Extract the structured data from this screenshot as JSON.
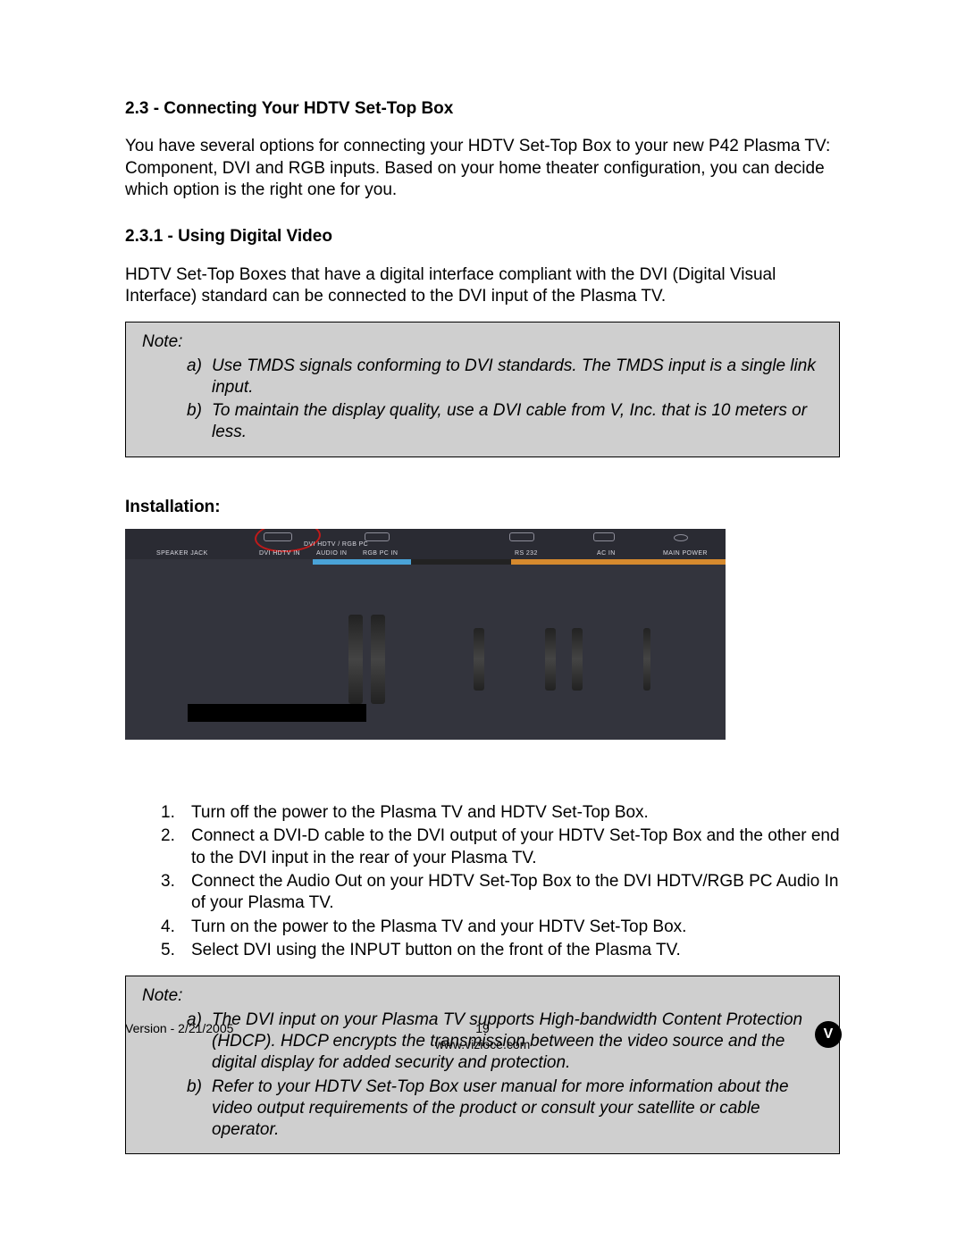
{
  "section": {
    "heading": "2.3 - Connecting Your HDTV Set-Top Box",
    "intro": "You have several options for connecting your HDTV Set-Top Box to your new P42 Plasma TV: Component, DVI and RGB inputs.  Based on your home theater configuration, you can decide which option is the right one for you."
  },
  "subsection": {
    "heading": "2.3.1 - Using Digital Video",
    "intro": "HDTV Set-Top Boxes that have a digital interface compliant with the DVI (Digital Visual Interface) standard can be connected to the DVI input of the Plasma TV."
  },
  "note1": {
    "label": "Note:",
    "items": [
      {
        "marker": "a)",
        "text": "Use TMDS signals conforming to DVI standards. The TMDS input is a single link input."
      },
      {
        "marker": "b)",
        "text": "To maintain the display quality, use a DVI cable from V, Inc. that is 10 meters or less."
      }
    ]
  },
  "installation": {
    "heading": "Installation:"
  },
  "diagram": {
    "labels": {
      "speaker_jack": "SPEAKER JACK",
      "dvi_hdtv_in": "DVI HDTV IN",
      "audio_in": "AUDIO IN",
      "dvi_rgb_pc": "DVI HDTV / RGB PC",
      "rgb_pc_in": "RGB PC IN",
      "rs232": "RS 232",
      "ac_in": "AC IN",
      "main_power": "MAIN POWER"
    }
  },
  "steps": [
    {
      "marker": "1.",
      "text": "Turn off the power to the Plasma TV and HDTV Set-Top Box."
    },
    {
      "marker": "2.",
      "text": "Connect a DVI-D cable to the DVI output of your HDTV Set-Top Box and the other end to the DVI input in the rear of your Plasma TV."
    },
    {
      "marker": "3.",
      "text": "Connect the Audio Out on your HDTV Set-Top Box to the DVI HDTV/RGB PC Audio In of your Plasma TV."
    },
    {
      "marker": "4.",
      "text": "Turn on the power to the Plasma TV and your HDTV Set-Top Box."
    },
    {
      "marker": "5.",
      "text": "Select DVI using the INPUT button on the front of the Plasma TV."
    }
  ],
  "note2": {
    "label": "Note:",
    "items": [
      {
        "marker": "a)",
        "text": "The DVI input on your Plasma TV supports High-bandwidth Content Protection (HDCP). HDCP encrypts the transmission between the video source and the digital display for added security and protection."
      },
      {
        "marker": "b)",
        "text": "Refer to your HDTV Set-Top Box user manual for more information about the video output requirements of the product or consult your satellite or cable operator."
      }
    ]
  },
  "footer": {
    "version": "Version - 2/21/2005",
    "page": "19",
    "url": "www.vizioce.com",
    "logo": "V"
  }
}
